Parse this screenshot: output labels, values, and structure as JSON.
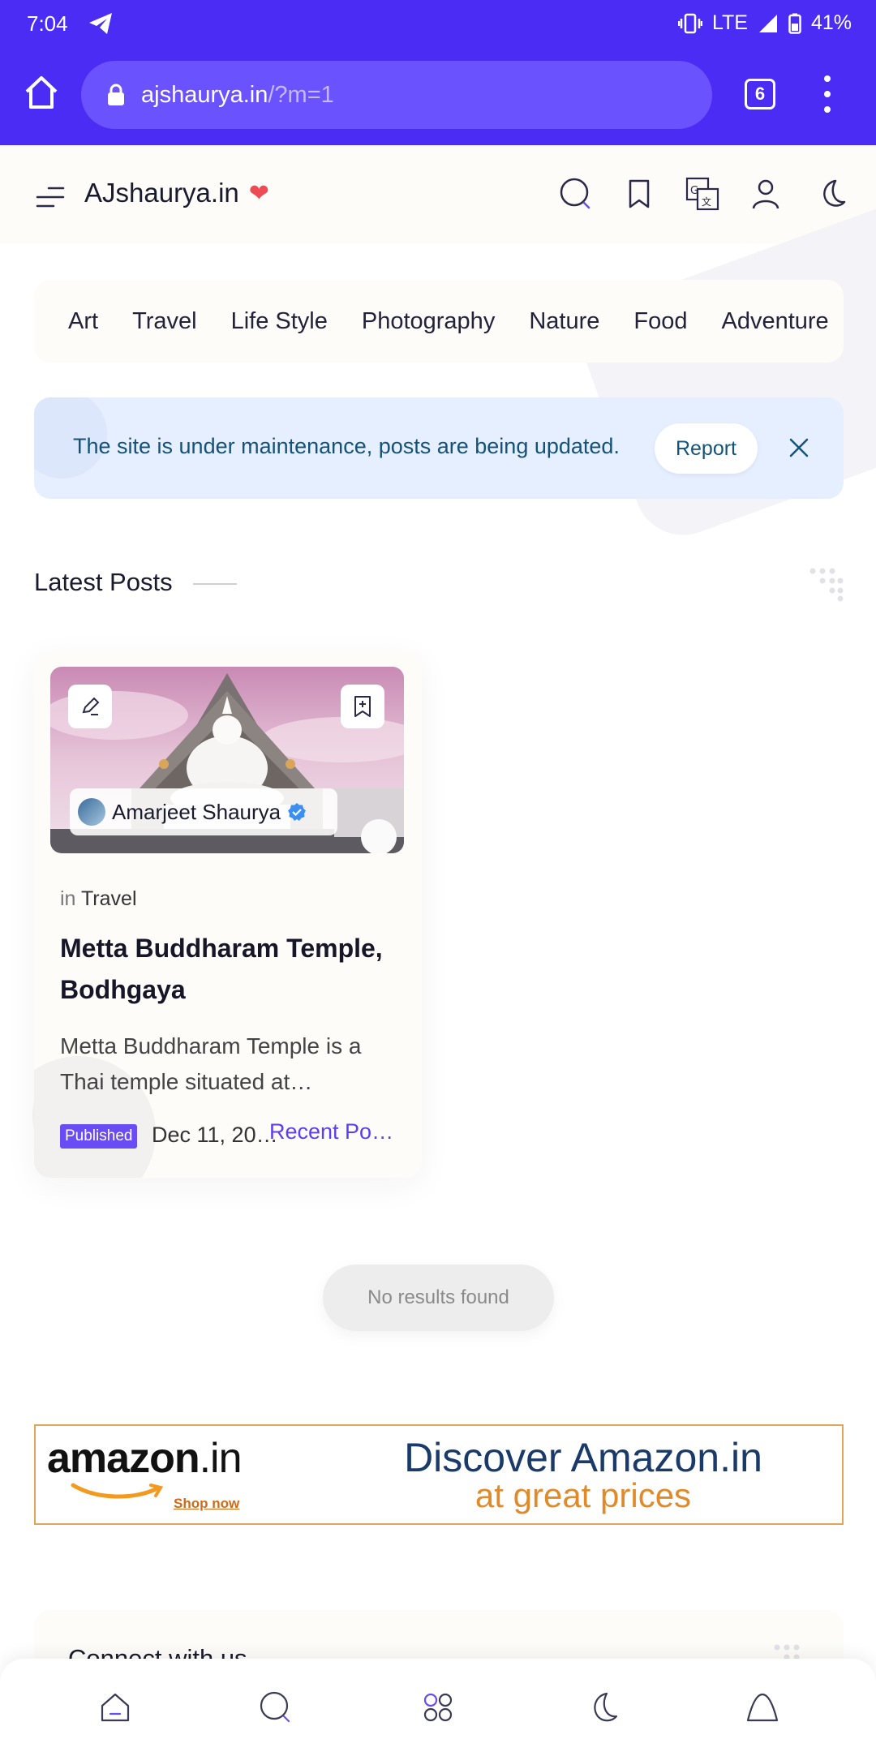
{
  "status_bar": {
    "time": "7:04",
    "network": "LTE",
    "battery": "41%"
  },
  "browser": {
    "url_host": "ajshaurya.in",
    "url_path": "/?m=1",
    "tab_count": "6"
  },
  "site": {
    "brand": "AJshaurya.in",
    "brand_heart": "❤"
  },
  "categories": [
    "Art",
    "Travel",
    "Life Style",
    "Photography",
    "Nature",
    "Food",
    "Adventure"
  ],
  "notice": {
    "text": "The site is under maintenance, posts are being updated.",
    "report_label": "Report"
  },
  "section": {
    "title": "Latest Posts"
  },
  "post": {
    "author": "Amarjeet Shaurya",
    "in_label": "in",
    "category": "Travel",
    "title": "Metta Buddharam Temple, Bodhgaya",
    "excerpt": "Metta Buddharam Temple is a Thai temple situated at…",
    "badge": "Published",
    "date": "Dec 11, 20…",
    "category_link": "Recent Po…"
  },
  "no_results": "No results found",
  "ad": {
    "logo": "amazon",
    "logo_suffix": ".in",
    "shop": "Shop now",
    "line1": "Discover Amazon.in",
    "line2": "at great prices"
  },
  "connect": {
    "title": "Connect with us"
  },
  "colors": {
    "chrome": "#4a2cf5",
    "accent": "#6a4cf5",
    "notice_bg": "#e6efff"
  }
}
